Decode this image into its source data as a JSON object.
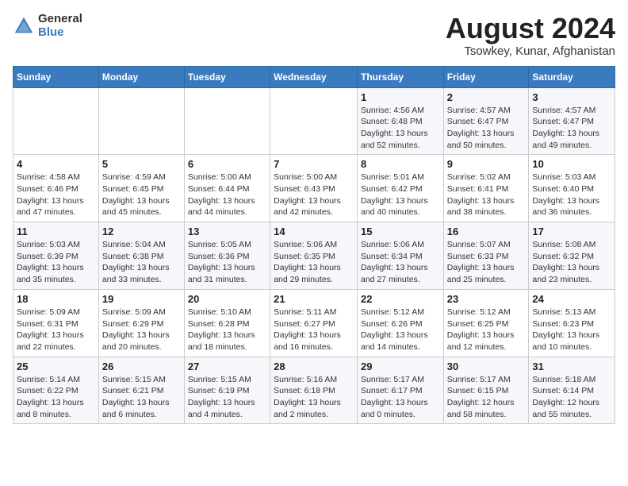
{
  "header": {
    "logo_general": "General",
    "logo_blue": "Blue",
    "title": "August 2024",
    "subtitle": "Tsowkey, Kunar, Afghanistan"
  },
  "weekdays": [
    "Sunday",
    "Monday",
    "Tuesday",
    "Wednesday",
    "Thursday",
    "Friday",
    "Saturday"
  ],
  "weeks": [
    [
      {
        "day": "",
        "info": ""
      },
      {
        "day": "",
        "info": ""
      },
      {
        "day": "",
        "info": ""
      },
      {
        "day": "",
        "info": ""
      },
      {
        "day": "1",
        "info": "Sunrise: 4:56 AM\nSunset: 6:48 PM\nDaylight: 13 hours\nand 52 minutes."
      },
      {
        "day": "2",
        "info": "Sunrise: 4:57 AM\nSunset: 6:47 PM\nDaylight: 13 hours\nand 50 minutes."
      },
      {
        "day": "3",
        "info": "Sunrise: 4:57 AM\nSunset: 6:47 PM\nDaylight: 13 hours\nand 49 minutes."
      }
    ],
    [
      {
        "day": "4",
        "info": "Sunrise: 4:58 AM\nSunset: 6:46 PM\nDaylight: 13 hours\nand 47 minutes."
      },
      {
        "day": "5",
        "info": "Sunrise: 4:59 AM\nSunset: 6:45 PM\nDaylight: 13 hours\nand 45 minutes."
      },
      {
        "day": "6",
        "info": "Sunrise: 5:00 AM\nSunset: 6:44 PM\nDaylight: 13 hours\nand 44 minutes."
      },
      {
        "day": "7",
        "info": "Sunrise: 5:00 AM\nSunset: 6:43 PM\nDaylight: 13 hours\nand 42 minutes."
      },
      {
        "day": "8",
        "info": "Sunrise: 5:01 AM\nSunset: 6:42 PM\nDaylight: 13 hours\nand 40 minutes."
      },
      {
        "day": "9",
        "info": "Sunrise: 5:02 AM\nSunset: 6:41 PM\nDaylight: 13 hours\nand 38 minutes."
      },
      {
        "day": "10",
        "info": "Sunrise: 5:03 AM\nSunset: 6:40 PM\nDaylight: 13 hours\nand 36 minutes."
      }
    ],
    [
      {
        "day": "11",
        "info": "Sunrise: 5:03 AM\nSunset: 6:39 PM\nDaylight: 13 hours\nand 35 minutes."
      },
      {
        "day": "12",
        "info": "Sunrise: 5:04 AM\nSunset: 6:38 PM\nDaylight: 13 hours\nand 33 minutes."
      },
      {
        "day": "13",
        "info": "Sunrise: 5:05 AM\nSunset: 6:36 PM\nDaylight: 13 hours\nand 31 minutes."
      },
      {
        "day": "14",
        "info": "Sunrise: 5:06 AM\nSunset: 6:35 PM\nDaylight: 13 hours\nand 29 minutes."
      },
      {
        "day": "15",
        "info": "Sunrise: 5:06 AM\nSunset: 6:34 PM\nDaylight: 13 hours\nand 27 minutes."
      },
      {
        "day": "16",
        "info": "Sunrise: 5:07 AM\nSunset: 6:33 PM\nDaylight: 13 hours\nand 25 minutes."
      },
      {
        "day": "17",
        "info": "Sunrise: 5:08 AM\nSunset: 6:32 PM\nDaylight: 13 hours\nand 23 minutes."
      }
    ],
    [
      {
        "day": "18",
        "info": "Sunrise: 5:09 AM\nSunset: 6:31 PM\nDaylight: 13 hours\nand 22 minutes."
      },
      {
        "day": "19",
        "info": "Sunrise: 5:09 AM\nSunset: 6:29 PM\nDaylight: 13 hours\nand 20 minutes."
      },
      {
        "day": "20",
        "info": "Sunrise: 5:10 AM\nSunset: 6:28 PM\nDaylight: 13 hours\nand 18 minutes."
      },
      {
        "day": "21",
        "info": "Sunrise: 5:11 AM\nSunset: 6:27 PM\nDaylight: 13 hours\nand 16 minutes."
      },
      {
        "day": "22",
        "info": "Sunrise: 5:12 AM\nSunset: 6:26 PM\nDaylight: 13 hours\nand 14 minutes."
      },
      {
        "day": "23",
        "info": "Sunrise: 5:12 AM\nSunset: 6:25 PM\nDaylight: 13 hours\nand 12 minutes."
      },
      {
        "day": "24",
        "info": "Sunrise: 5:13 AM\nSunset: 6:23 PM\nDaylight: 13 hours\nand 10 minutes."
      }
    ],
    [
      {
        "day": "25",
        "info": "Sunrise: 5:14 AM\nSunset: 6:22 PM\nDaylight: 13 hours\nand 8 minutes."
      },
      {
        "day": "26",
        "info": "Sunrise: 5:15 AM\nSunset: 6:21 PM\nDaylight: 13 hours\nand 6 minutes."
      },
      {
        "day": "27",
        "info": "Sunrise: 5:15 AM\nSunset: 6:19 PM\nDaylight: 13 hours\nand 4 minutes."
      },
      {
        "day": "28",
        "info": "Sunrise: 5:16 AM\nSunset: 6:18 PM\nDaylight: 13 hours\nand 2 minutes."
      },
      {
        "day": "29",
        "info": "Sunrise: 5:17 AM\nSunset: 6:17 PM\nDaylight: 13 hours\nand 0 minutes."
      },
      {
        "day": "30",
        "info": "Sunrise: 5:17 AM\nSunset: 6:15 PM\nDaylight: 12 hours\nand 58 minutes."
      },
      {
        "day": "31",
        "info": "Sunrise: 5:18 AM\nSunset: 6:14 PM\nDaylight: 12 hours\nand 55 minutes."
      }
    ]
  ]
}
